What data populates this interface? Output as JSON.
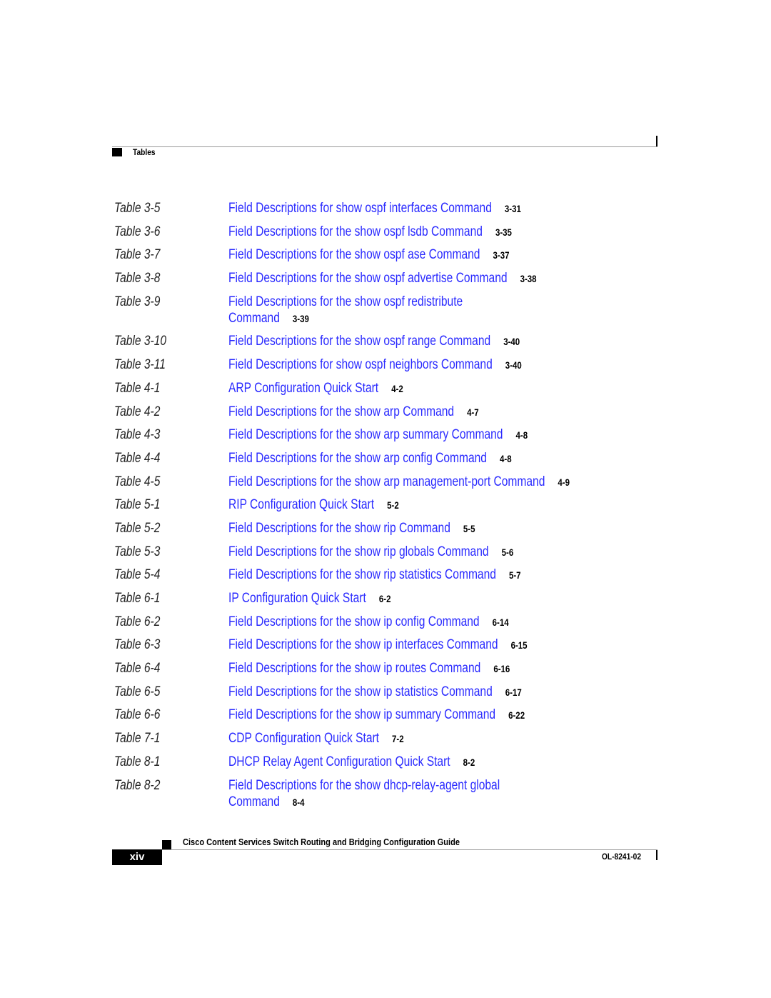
{
  "header": {
    "section_title": "Tables"
  },
  "colors": {
    "link": "#2a2aff",
    "text": "#000000"
  },
  "entries": [
    {
      "label": "Table 3-5",
      "title": "Field Descriptions for show ospf interfaces Command",
      "page": "3-31"
    },
    {
      "label": "Table 3-6",
      "title": "Field Descriptions for the show ospf lsdb Command",
      "page": "3-35"
    },
    {
      "label": "Table 3-7",
      "title": "Field Descriptions for the show ospf ase Command",
      "page": "3-37"
    },
    {
      "label": "Table 3-8",
      "title": "Field Descriptions for the show ospf advertise Command",
      "page": "3-38"
    },
    {
      "label": "Table 3-9",
      "title": "Field Descriptions for the show ospf redistribute",
      "title_cont": "Command",
      "page": "3-39"
    },
    {
      "label": "Table 3-10",
      "title": "Field Descriptions for the show ospf range Command",
      "page": "3-40"
    },
    {
      "label": "Table 3-11",
      "title": "Field Descriptions for show ospf neighbors Command",
      "page": "3-40"
    },
    {
      "label": "Table 4-1",
      "title": "ARP Configuration Quick Start",
      "page": "4-2"
    },
    {
      "label": "Table 4-2",
      "title": "Field Descriptions for the show arp Command",
      "page": "4-7"
    },
    {
      "label": "Table 4-3",
      "title": "Field Descriptions for the show arp summary Command",
      "page": "4-8"
    },
    {
      "label": "Table 4-4",
      "title": "Field Descriptions for the show arp config Command",
      "page": "4-8"
    },
    {
      "label": "Table 4-5",
      "title": "Field Descriptions for the show arp management-port Command",
      "page": "4-9"
    },
    {
      "label": "Table 5-1",
      "title": "RIP Configuration Quick Start",
      "page": "5-2"
    },
    {
      "label": "Table 5-2",
      "title": "Field Descriptions for the show rip Command",
      "page": "5-5"
    },
    {
      "label": "Table 5-3",
      "title": "Field Descriptions for the show rip globals Command",
      "page": "5-6"
    },
    {
      "label": "Table 5-4",
      "title": "Field Descriptions for the show rip statistics Command",
      "page": "5-7"
    },
    {
      "label": "Table 6-1",
      "title": "IP Configuration Quick Start",
      "page": "6-2"
    },
    {
      "label": "Table 6-2",
      "title": "Field Descriptions for the show ip config Command",
      "page": "6-14"
    },
    {
      "label": "Table 6-3",
      "title": "Field Descriptions for the show ip interfaces Command",
      "page": "6-15"
    },
    {
      "label": "Table 6-4",
      "title": "Field Descriptions for the show ip routes Command",
      "page": "6-16"
    },
    {
      "label": "Table 6-5",
      "title": "Field Descriptions for the show ip statistics Command",
      "page": "6-17"
    },
    {
      "label": "Table 6-6",
      "title": "Field Descriptions for the show ip summary Command",
      "page": "6-22"
    },
    {
      "label": "Table 7-1",
      "title": "CDP Configuration Quick Start",
      "page": "7-2"
    },
    {
      "label": "Table 8-1",
      "title": "DHCP Relay Agent Configuration Quick Start",
      "page": "8-2"
    },
    {
      "label": "Table 8-2",
      "title": "Field Descriptions for the show dhcp-relay-agent global",
      "title_cont": "Command",
      "page": "8-4"
    }
  ],
  "footer": {
    "book_title": "Cisco Content Services Switch Routing and Bridging Configuration Guide",
    "page_number": "xiv",
    "doc_number": "OL-8241-02"
  }
}
